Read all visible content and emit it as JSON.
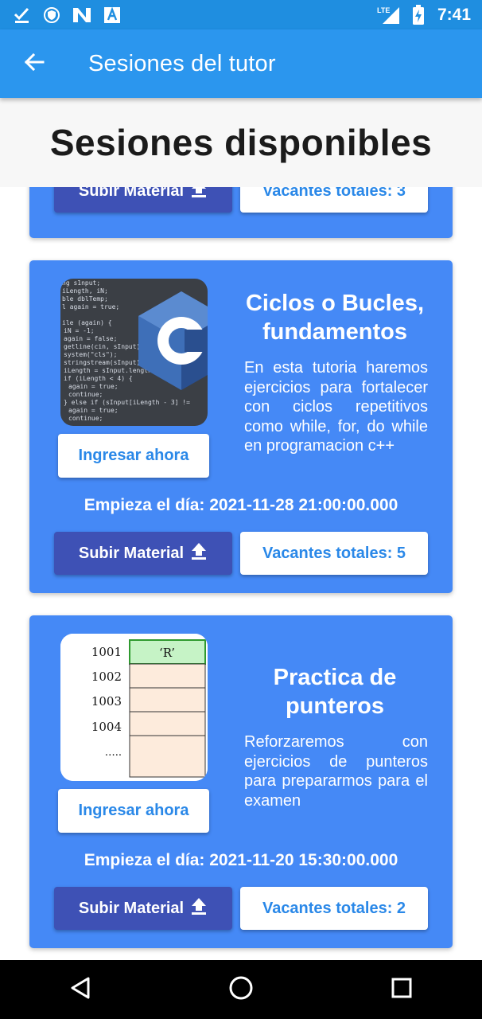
{
  "status_bar": {
    "time": "7:41",
    "left_icons": [
      "check-download-icon",
      "shield-icon",
      "n-app-icon",
      "font-app-icon"
    ],
    "right_icons": [
      "lte-signal-icon",
      "battery-charging-icon"
    ],
    "network": "LTE"
  },
  "app_bar": {
    "title": "Sesiones del tutor",
    "back_icon": "arrow-left-icon"
  },
  "page": {
    "heading": "Sesiones disponibles"
  },
  "colors": {
    "status_bar": "#1f8ee0",
    "app_bar": "#2b96ee",
    "card_bg": "#4589f6",
    "subir_button": "#3e51b5",
    "accent_text": "#2a88e8"
  },
  "sessions": [
    {
      "upload_label": "Subir Material",
      "upload_icon": "upload-icon",
      "vacancies_label": "Vacantes totales: 3"
    },
    {
      "title": "Ciclos o Bucles, fundamentos",
      "description": "En esta tutoria haremos ejercicios para fortalecer con ciclos repetitivos como while, for, do while en programacion c++",
      "image": "cpp-code-image",
      "join_label": "Ingresar ahora",
      "date_label": "Empieza el día:  2021-11-28 21:00:00.000",
      "upload_label": "Subir Material",
      "upload_icon": "upload-icon",
      "vacancies_label": "Vacantes totales: 5"
    },
    {
      "title": "Practica de punteros",
      "description": "Reforzaremos con ejercicios de punteros para prepararmos para el examen",
      "image": "memory-pointer-diagram",
      "memory_addresses": [
        "1001",
        "1002",
        "1003",
        "1004",
        "….."
      ],
      "memory_value": "‘R’",
      "join_label": "Ingresar ahora",
      "date_label": "Empieza el día:  2021-11-20 15:30:00.000",
      "upload_label": "Subir Material",
      "upload_icon": "upload-icon",
      "vacancies_label": "Vacantes totales: 2"
    }
  ],
  "nav_bar": {
    "buttons": [
      "back-triangle-icon",
      "home-circle-icon",
      "recents-square-icon"
    ]
  }
}
